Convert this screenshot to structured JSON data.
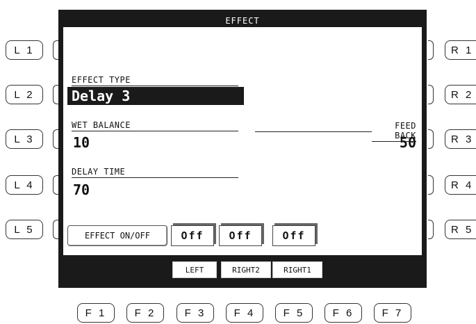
{
  "screen": {
    "title": "EFFECT",
    "effect_type_label": "EFFECT TYPE",
    "effect_type_value": "Delay 3",
    "wet_balance_label": "WET BALANCE",
    "wet_balance_value": "10",
    "feed_back_label": "FEED BACK",
    "feed_back_value": "50",
    "delay_time_label": "DELAY TIME",
    "delay_time_value": "70",
    "effect_onoff_label": "EFFECT ON/OFF",
    "toggles": [
      {
        "value": "Off"
      },
      {
        "value": "Off"
      },
      {
        "value": "Off"
      }
    ],
    "function_labels": [
      "LEFT",
      "RIGHT2",
      "RIGHT1"
    ]
  },
  "left_buttons": [
    "L1",
    "L2",
    "L3",
    "L4",
    "L5"
  ],
  "right_buttons": [
    "R1",
    "R2",
    "R3",
    "R4",
    "R5"
  ],
  "f_buttons": [
    "F1",
    "F2",
    "F3",
    "F4",
    "F5",
    "F6",
    "F7"
  ]
}
